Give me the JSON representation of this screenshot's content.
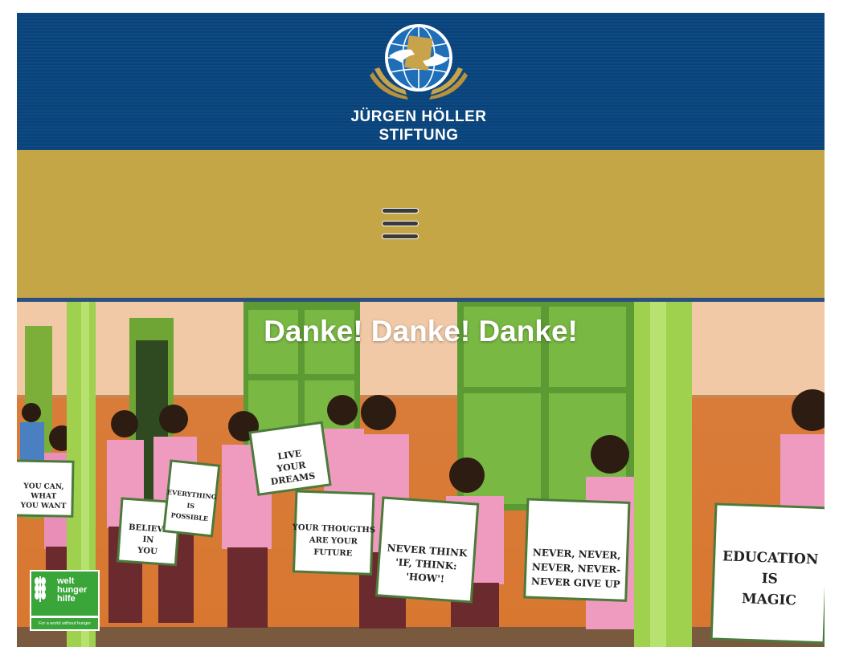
{
  "header": {
    "logo_line1": "JÜRGEN HÖLLER",
    "logo_line2": "STIFTUNG",
    "logo_icon": "globe-hands-book-icon",
    "background_color": "#0d4a84"
  },
  "nav": {
    "menu_icon": "hamburger-menu-icon",
    "background_color": "#c4a646"
  },
  "hero": {
    "title": "Danke! Danke! Danke!",
    "signs": [
      [
        "YOU CAN,",
        "WHAT",
        "YOU WANT"
      ],
      [
        "BELIEVE",
        "IN",
        "YOU"
      ],
      [
        "EVERYTHING",
        "IS",
        "POSSIBLE"
      ],
      [
        "LIVE",
        "YOUR",
        "DREAMS"
      ],
      [
        "YOUR THOUGTHS",
        "ARE YOUR",
        "FUTURE"
      ],
      [
        "NEVER THINK",
        "'IF, THINK:",
        "'HOW'!"
      ],
      [
        "NEVER, NEVER,",
        "NEVER, NEVER-",
        "NEVER GIVE UP"
      ],
      [
        "EDUCATION",
        "IS",
        "MAGIC"
      ]
    ],
    "badge": {
      "name_line1": "welt",
      "name_line2": "hunger",
      "name_line3": "hilfe",
      "tagline": "For a world without hunger",
      "icon": "wheat-icon",
      "color": "#3aa539"
    }
  }
}
